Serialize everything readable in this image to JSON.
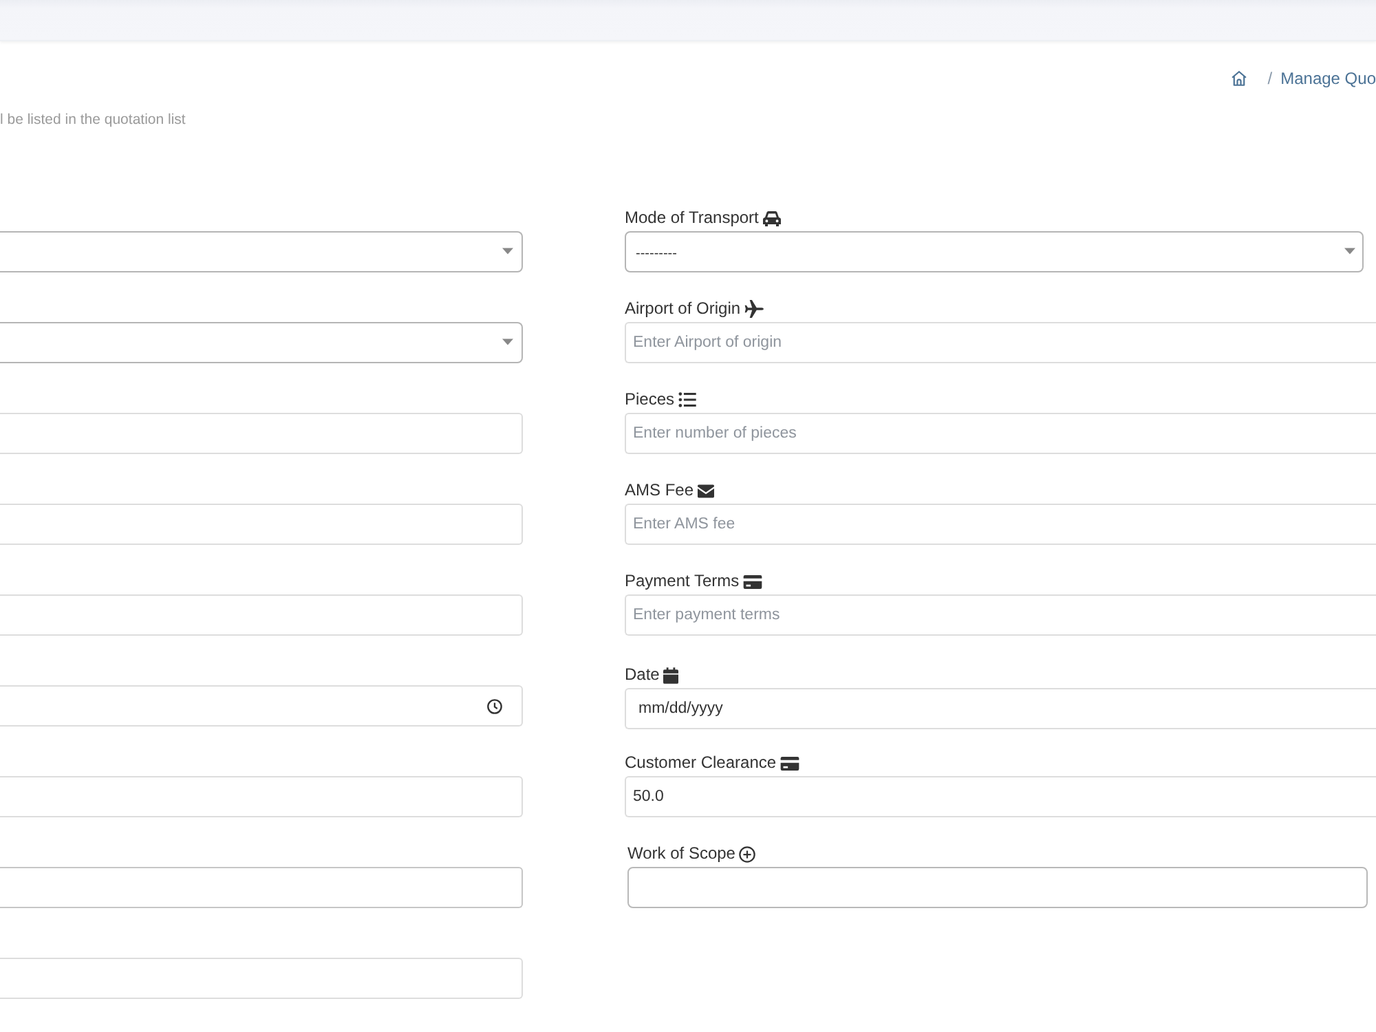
{
  "breadcrumb": {
    "separator": "/",
    "current": "Manage Quo"
  },
  "subtitle": "l be listed in the quotation list",
  "left_fields": [
    {
      "kind": "select"
    },
    {
      "kind": "select"
    },
    {
      "kind": "text"
    },
    {
      "kind": "text"
    },
    {
      "kind": "text"
    },
    {
      "kind": "time"
    },
    {
      "kind": "text"
    },
    {
      "kind": "textarea"
    },
    {
      "kind": "text"
    }
  ],
  "right_fields": [
    {
      "kind": "select",
      "label": "Mode of Transport",
      "value": "---------"
    },
    {
      "kind": "text",
      "label": "Airport of Origin",
      "placeholder": "Enter Airport of origin"
    },
    {
      "kind": "text",
      "label": "Pieces",
      "placeholder": "Enter number of pieces"
    },
    {
      "kind": "text",
      "label": "AMS Fee",
      "placeholder": "Enter AMS fee"
    },
    {
      "kind": "text",
      "label": "Payment Terms",
      "placeholder": "Enter payment terms"
    },
    {
      "kind": "date",
      "label": "Date",
      "value": "mm/dd/yyyy"
    },
    {
      "kind": "text",
      "label": "Customer Clearance",
      "value": "50.0"
    },
    {
      "kind": "textarea",
      "label": "Work of Scope"
    }
  ]
}
